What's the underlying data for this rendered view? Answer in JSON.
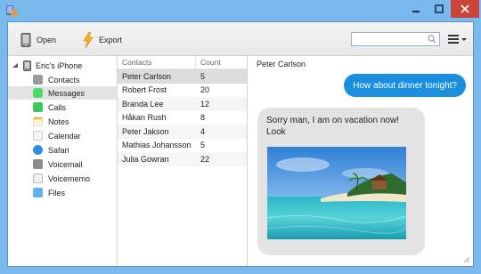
{
  "toolbar": {
    "open_label": "Open",
    "export_label": "Export",
    "search_value": ""
  },
  "tree": {
    "root_label": "Eric's iPhone",
    "items": [
      {
        "label": "Contacts",
        "icon": "contacts-icon"
      },
      {
        "label": "Messages",
        "icon": "messages-icon"
      },
      {
        "label": "Calls",
        "icon": "calls-icon"
      },
      {
        "label": "Notes",
        "icon": "notes-icon"
      },
      {
        "label": "Calendar",
        "icon": "calendar-icon"
      },
      {
        "label": "Safari",
        "icon": "safari-icon"
      },
      {
        "label": "Voicemail",
        "icon": "voicemail-icon"
      },
      {
        "label": "Voicememo",
        "icon": "voicememo-icon"
      },
      {
        "label": "Files",
        "icon": "files-icon"
      }
    ],
    "selected": "Messages"
  },
  "contacts_table": {
    "headers": [
      "Contacts",
      "Count"
    ],
    "rows": [
      {
        "name": "Peter Carlson",
        "count": "5"
      },
      {
        "name": "Robert Frost",
        "count": "20"
      },
      {
        "name": "Branda Lee",
        "count": "12"
      },
      {
        "name": "Håkan Rush",
        "count": "8"
      },
      {
        "name": "Peter Jakson",
        "count": "4"
      },
      {
        "name": "Mathias Johansson",
        "count": "5"
      },
      {
        "name": "Julia Gowran",
        "count": "22"
      }
    ]
  },
  "conversation": {
    "contact": "Peter Carlson",
    "outgoing": "How about dinner tonight?",
    "incoming": "Sorry man, I am on vacation now! Look"
  },
  "colors": {
    "titlebar": "#7ab9ee",
    "close": "#c9453a",
    "bubble_out": "#1a8fe0",
    "bubble_in": "#e3e3e3"
  }
}
